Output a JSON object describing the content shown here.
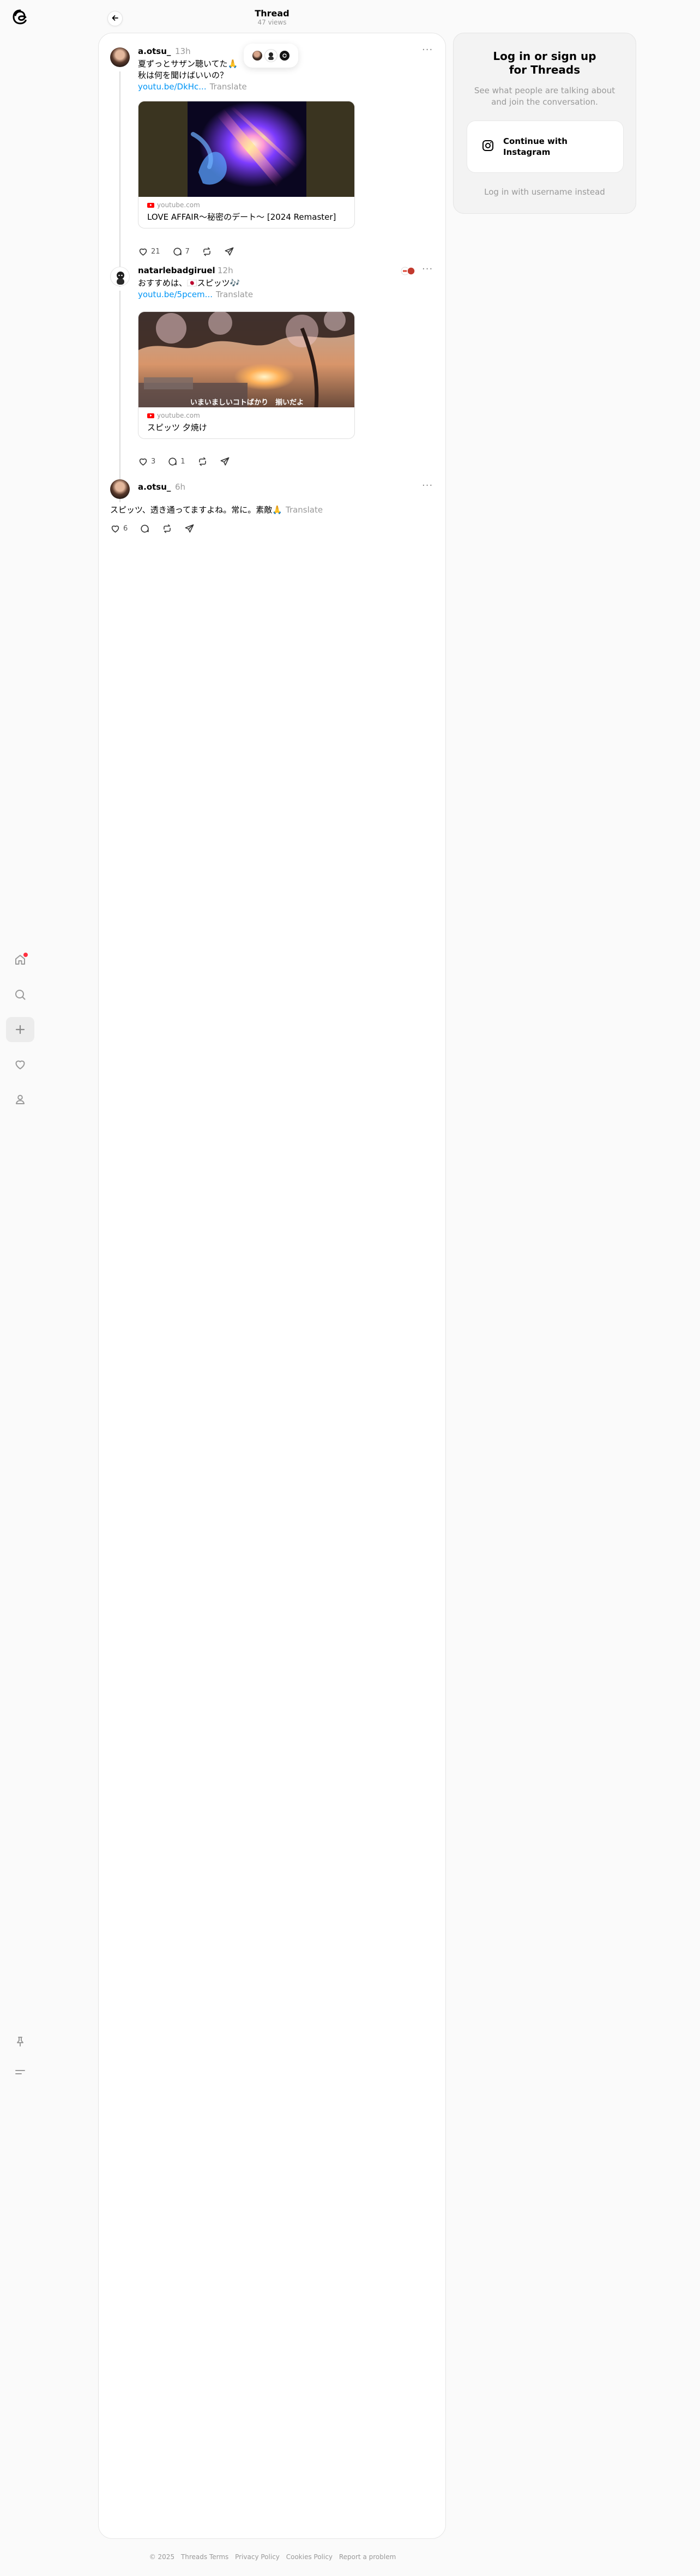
{
  "header": {
    "title": "Thread",
    "views": "47 views"
  },
  "posts": [
    {
      "username": "a.otsu_",
      "time": "13h",
      "lines": [
        "夏ずっとサザン聴いてた🙏",
        "秋は何を聞けばいいの？"
      ],
      "link": "youtu.be/DkHc...",
      "translate": "Translate",
      "card": {
        "site": "youtube.com",
        "title": "LOVE AFFAIR〜秘密のデート〜 [2024 Remaster]"
      },
      "likes": "21",
      "replies": "7"
    },
    {
      "username": "natarlebadgiruel",
      "time": "12h",
      "lines": [
        "おすすめは、🇯🇵スピッツ🎶"
      ],
      "link": "youtu.be/5pcem...",
      "translate": "Translate",
      "card": {
        "site": "youtube.com",
        "title": "スピッツ 夕焼け",
        "overlay_text": "いまいましいコトばかり　揃いだよ"
      },
      "likes": "3",
      "replies": "1"
    },
    {
      "username": "a.otsu_",
      "time": "6h",
      "text": "スピッツ、透き通ってますよね。常に。素敵🙏",
      "translate": "Translate",
      "likes": "6"
    }
  ],
  "login": {
    "title_line1": "Log in or sign up",
    "title_line2": "for Threads",
    "sub_line1": "See what people are talking about",
    "sub_line2": "and join the conversation.",
    "button_line1": "Continue with",
    "button_line2": "Instagram",
    "alt": "Log in with username instead"
  },
  "footer": [
    "© 2025",
    "Threads Terms",
    "Privacy Policy",
    "Cookies Policy",
    "Report a problem"
  ],
  "icons": {
    "logo": "threads-logo-icon",
    "nav": [
      "home-icon",
      "search-icon",
      "create-icon",
      "heart-icon",
      "profile-icon"
    ],
    "bottom": [
      "pin-icon",
      "menu-icon"
    ]
  },
  "colors": {
    "link": "#0095f6",
    "notification": "#ff3040",
    "muted": "#999999"
  }
}
